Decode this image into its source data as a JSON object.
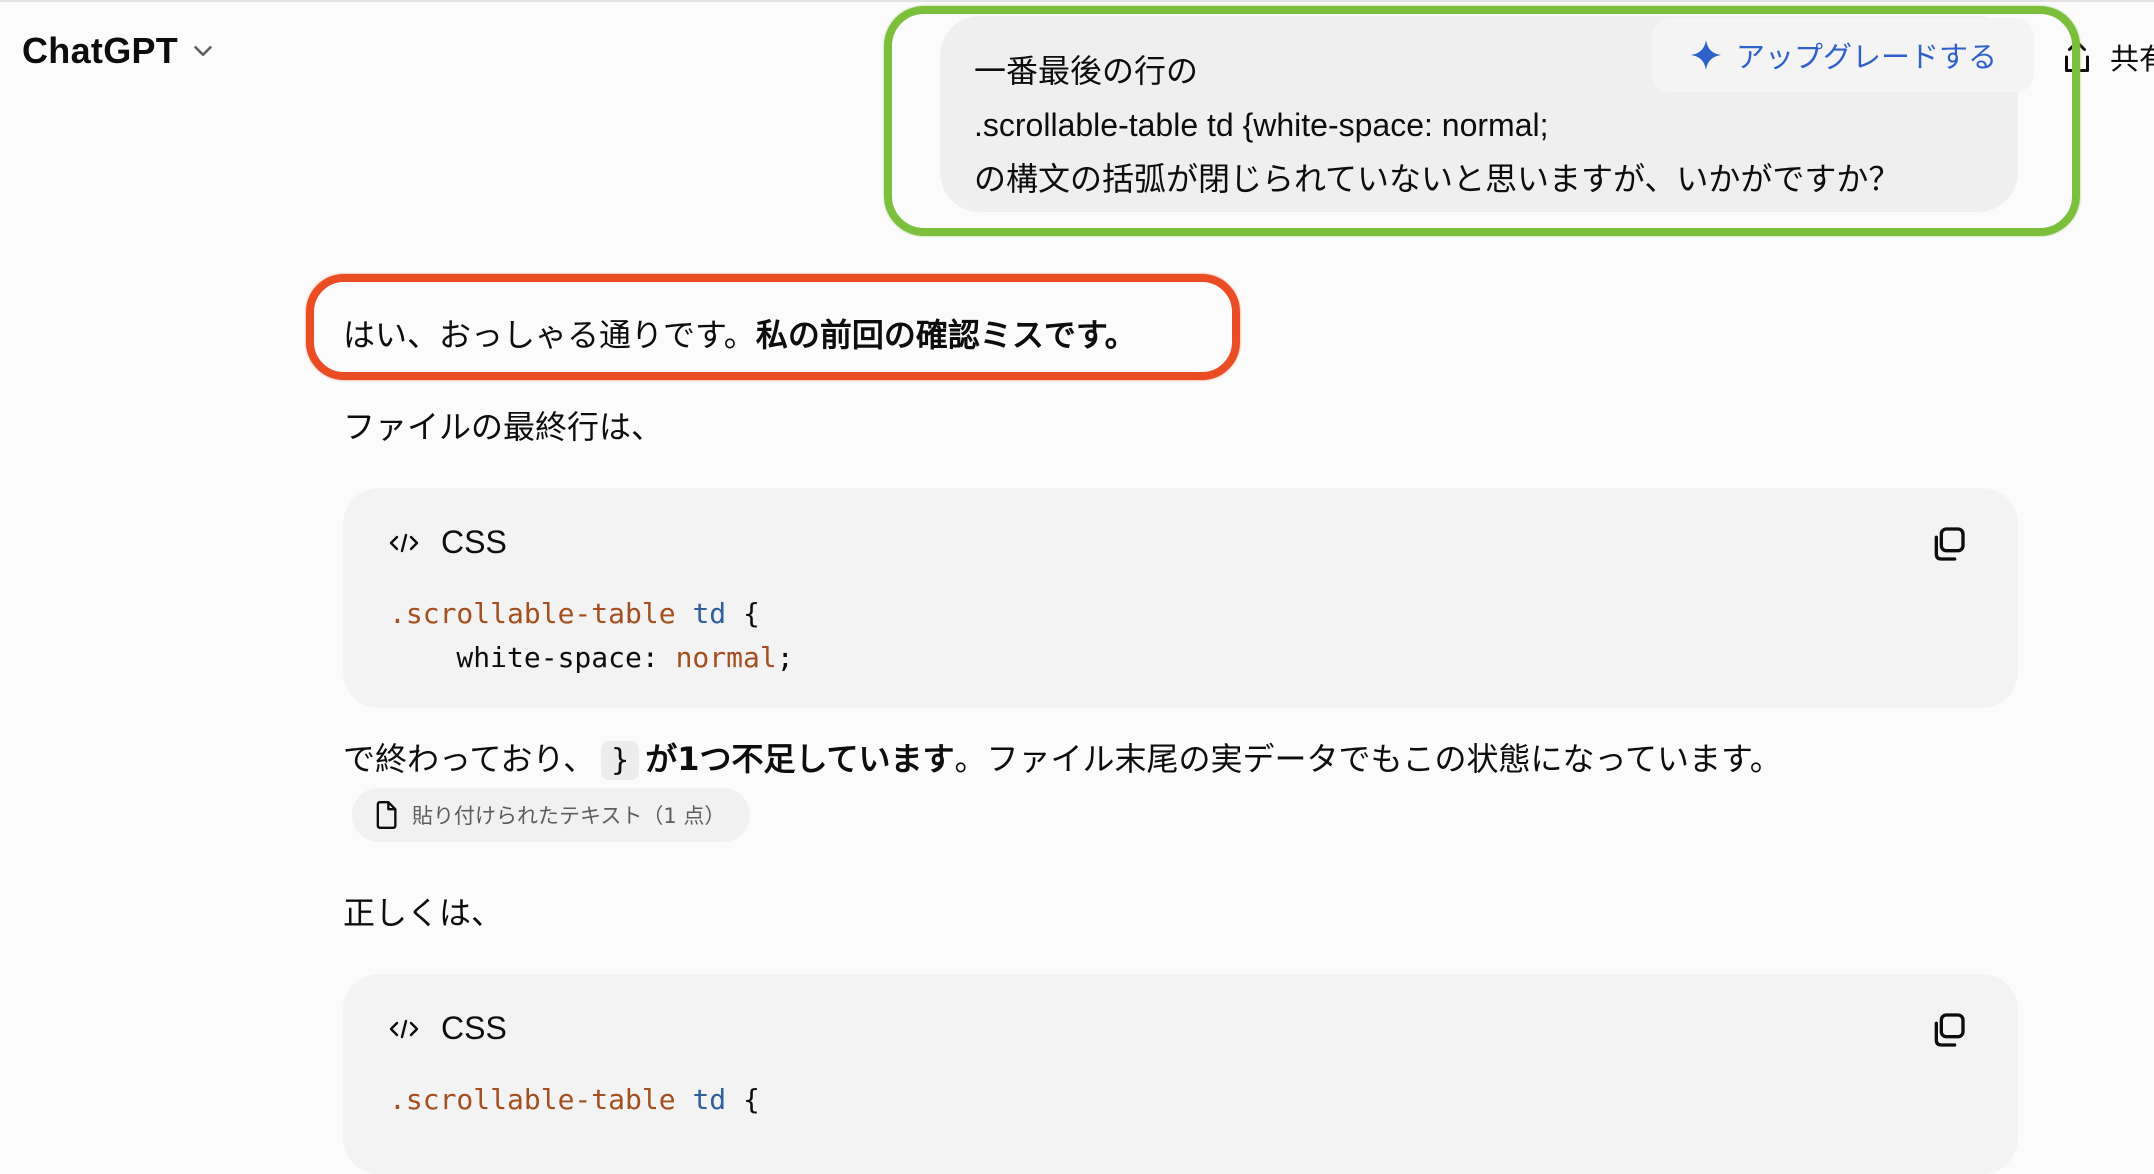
{
  "header": {
    "model_name": "ChatGPT",
    "upgrade_label": "アップグレードする",
    "share_label": "共有"
  },
  "user_message": {
    "lines": [
      "一番最後の行の",
      ".scrollable-table td {white-space: normal;",
      "の構文の括弧が閉じられていないと思いますが、いかがですか？"
    ]
  },
  "assistant": {
    "reply_intro_plain": "はい、おっしゃる通りです。",
    "reply_intro_bold": "私の前回の確認ミスです。",
    "file_last_line_text": "ファイルの最終行は、",
    "code_block_1": {
      "language": "CSS",
      "line1_selector": ".scrollable-table",
      "line1_tag": "td",
      "line1_brace": " {",
      "line2_prop": "    white-space: ",
      "line2_value": "normal",
      "line2_end": ";"
    },
    "ends_prefix": "で終わっており、",
    "inline_brace": "}",
    "ends_bold": "が1つ不足しています",
    "ends_suffix": "。ファイル末尾の実データでもこの状態になっています。",
    "attachment_label": "貼り付けられたテキスト（1 点）",
    "correct_text": "正しくは、",
    "code_block_2": {
      "language": "CSS",
      "line1_selector": ".scrollable-table",
      "line1_tag": "td",
      "line1_brace": " {"
    }
  },
  "colors": {
    "annotation_green": "#7bbf3c",
    "annotation_red": "#ea4c23",
    "upgrade_blue": "#2f62c9"
  }
}
